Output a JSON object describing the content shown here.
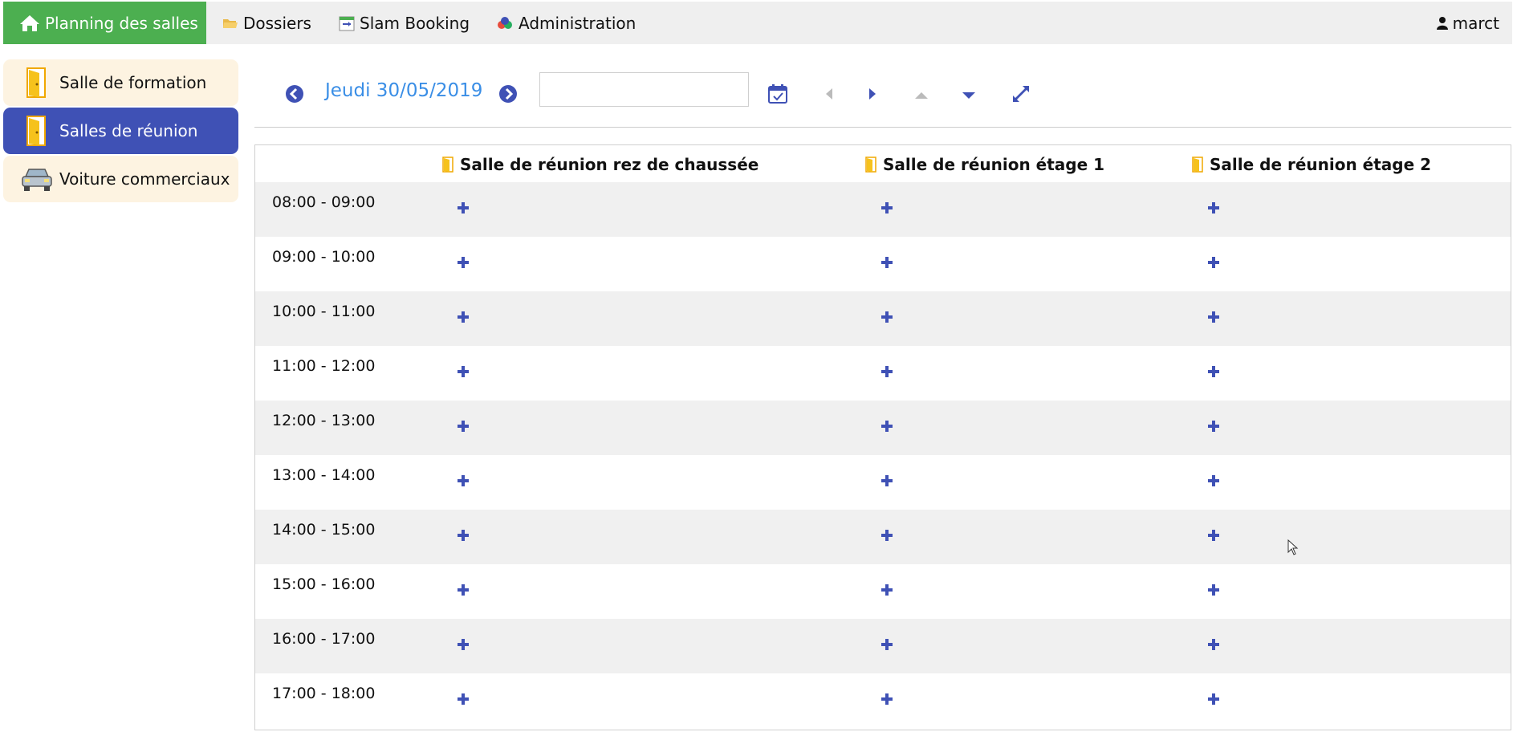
{
  "navbar": {
    "home_label": "Planning des salles",
    "items": [
      {
        "label": "Dossiers",
        "icon": "folder-icon"
      },
      {
        "label": "Slam Booking",
        "icon": "calendar-app-icon"
      },
      {
        "label": "Administration",
        "icon": "admin-circles-icon"
      }
    ],
    "user": "marct"
  },
  "sidebar": {
    "items": [
      {
        "label": "Salle de formation",
        "icon": "door-icon",
        "active": false
      },
      {
        "label": "Salles de réunion",
        "icon": "door-icon",
        "active": true
      },
      {
        "label": "Voiture commerciaux",
        "icon": "car-icon",
        "active": false
      }
    ]
  },
  "toolbar": {
    "date_label": "Jeudi 30/05/2019",
    "date_input_value": ""
  },
  "grid": {
    "rooms": [
      "Salle de réunion rez de chaussée",
      "Salle de réunion étage 1",
      "Salle de réunion étage 2"
    ],
    "slots": [
      "08:00 - 09:00",
      "09:00 - 10:00",
      "10:00 - 11:00",
      "11:00 - 12:00",
      "12:00 - 13:00",
      "13:00 - 14:00",
      "14:00 - 15:00",
      "15:00 - 16:00",
      "16:00 - 17:00",
      "17:00 - 18:00"
    ]
  },
  "colors": {
    "home_green": "#4caf50",
    "active_blue": "#3f51b5",
    "date_blue": "#3a8ee6",
    "sidebar_cream": "#fdf3e1",
    "row_gray": "#f0f0f0"
  }
}
